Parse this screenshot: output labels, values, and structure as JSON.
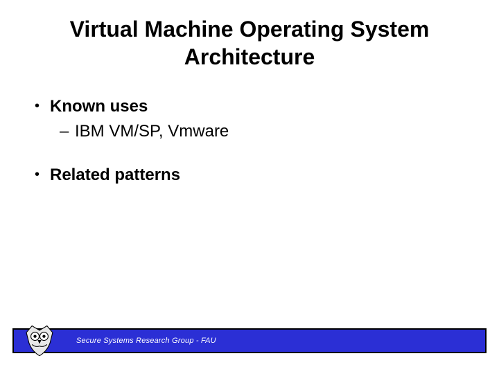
{
  "title_line1": "Virtual Machine Operating System",
  "title_line2": "Architecture",
  "bullets": {
    "b1": "Known uses",
    "b1_sub": "IBM VM/SP, Vmware",
    "b2": "Related patterns"
  },
  "footer": "Secure Systems Research Group - FAU"
}
